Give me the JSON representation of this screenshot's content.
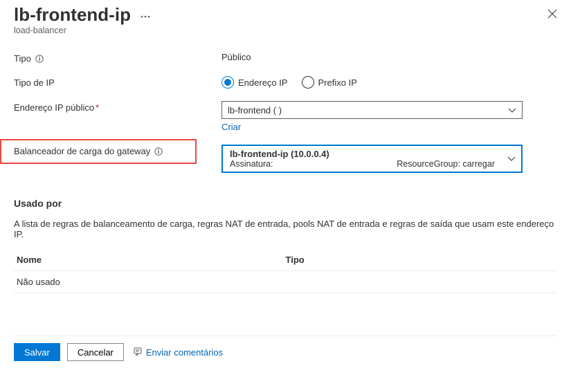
{
  "header": {
    "title": "lb-frontend-ip",
    "subtitle": "load-balancer"
  },
  "form": {
    "tipo": {
      "label": "Tipo",
      "value": "Público"
    },
    "tipo_de_ip": {
      "label": "Tipo de IP",
      "options": {
        "endereco": "Endereço IP",
        "prefixo": "Prefixo IP"
      },
      "selected": "endereco"
    },
    "endereco_publico": {
      "label": "Endereço IP público",
      "value": "lb-frontend (                        )",
      "create_link": "Criar"
    },
    "gateway_lb": {
      "label": "Balanceador de carga do gateway",
      "value_line1": "lb-frontend-ip (10.0.0.4)",
      "value_sub_label": "Assinatura:",
      "value_rg_label": "ResourceGroup: carregar"
    }
  },
  "used_by": {
    "title": "Usado por",
    "description": "A lista de regras de balanceamento de carga, regras NAT de entrada, pools NAT de entrada e regras de saída que usam este endereço IP.",
    "columns": {
      "name": "Nome",
      "type": "Tipo"
    },
    "rows": [
      {
        "name": "Não usado",
        "type": ""
      }
    ]
  },
  "footer": {
    "save": "Salvar",
    "cancel": "Cancelar",
    "feedback": "Enviar comentários"
  }
}
